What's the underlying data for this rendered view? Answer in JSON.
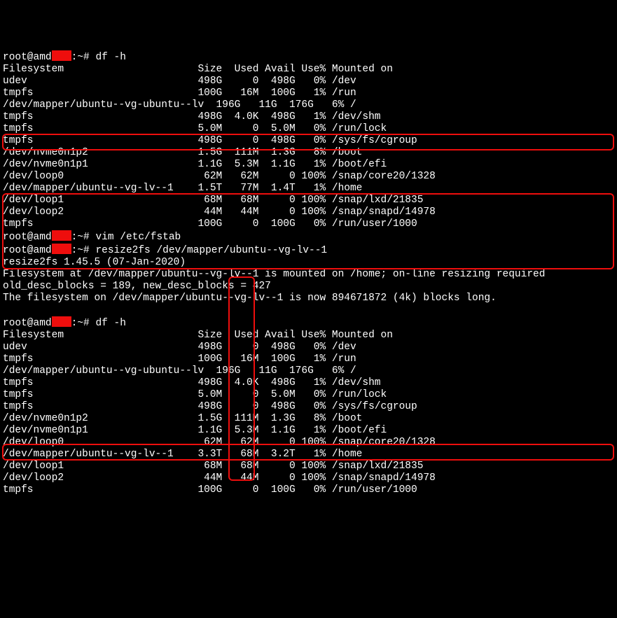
{
  "prompt_user": "root@amd",
  "prompt_suffix": ":~# ",
  "cmd_df": "df -h",
  "cmd_vim": "vim /etc/fstab",
  "cmd_resize": "resize2fs /dev/mapper/ubuntu--vg-lv--1",
  "df_header": "Filesystem                      Size  Used Avail Use% Mounted on",
  "df1": [
    "udev                            498G     0  498G   0% /dev",
    "tmpfs                           100G   16M  100G   1% /run",
    "/dev/mapper/ubuntu--vg-ubuntu--lv  196G   11G  176G   6% /",
    "tmpfs                           498G  4.0K  498G   1% /dev/shm",
    "tmpfs                           5.0M     0  5.0M   0% /run/lock",
    "tmpfs                           498G     0  498G   0% /sys/fs/cgroup",
    "/dev/nvme0n1p2                  1.5G  111M  1.3G   8% /boot",
    "/dev/nvme0n1p1                  1.1G  5.3M  1.1G   1% /boot/efi",
    "/dev/loop0                       62M   62M     0 100% /snap/core20/1328",
    "/dev/mapper/ubuntu--vg-lv--1    1.5T   77M  1.4T   1% /home",
    "/dev/loop1                       68M   68M     0 100% /snap/lxd/21835",
    "/dev/loop2                       44M   44M     0 100% /snap/snapd/14978",
    "tmpfs                           100G     0  100G   0% /run/user/1000"
  ],
  "resize_out": [
    "resize2fs 1.45.5 (07-Jan-2020)",
    "Filesystem at /dev/mapper/ubuntu--vg-lv--1 is mounted on /home; on-line resizing required",
    "old_desc_blocks = 189, new_desc_blocks = 427",
    "The filesystem on /dev/mapper/ubuntu--vg-lv--1 is now 894671872 (4k) blocks long.",
    ""
  ],
  "df2": [
    "udev                            498G     0  498G   0% /dev",
    "tmpfs                           100G   16M  100G   1% /run",
    "/dev/mapper/ubuntu--vg-ubuntu--lv  196G   11G  176G   6% /",
    "tmpfs                           498G  4.0K  498G   1% /dev/shm",
    "tmpfs                           5.0M     0  5.0M   0% /run/lock",
    "tmpfs                           498G     0  498G   0% /sys/fs/cgroup",
    "/dev/nvme0n1p2                  1.5G  111M  1.3G   8% /boot",
    "/dev/nvme0n1p1                  1.1G  5.3M  1.1G   1% /boot/efi",
    "/dev/loop0                       62M   62M     0 100% /snap/core20/1328",
    "/dev/mapper/ubuntu--vg-lv--1    3.3T   68M  3.2T   1% /home",
    "/dev/loop1                       68M   68M     0 100% /snap/lxd/21835",
    "/dev/loop2                       44M   44M     0 100% /snap/snapd/14978",
    "tmpfs                           100G     0  100G   0% /run/user/1000"
  ]
}
